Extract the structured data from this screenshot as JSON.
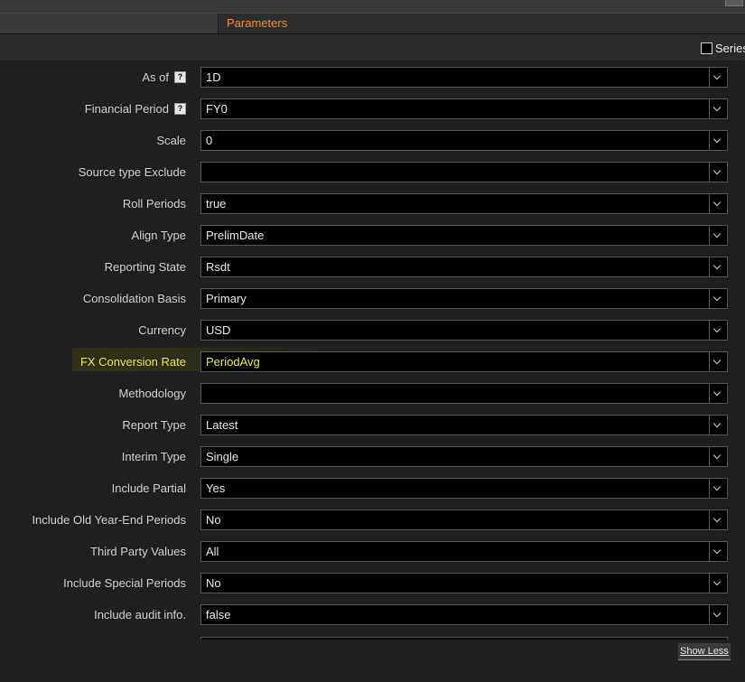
{
  "tabs": {
    "active_label": "Parameters"
  },
  "series": {
    "label": "Series",
    "checked": false
  },
  "fields": [
    {
      "label": "As of",
      "value": "1D",
      "help": "?"
    },
    {
      "label": "Financial Period",
      "value": "FY0",
      "help": "?"
    },
    {
      "label": "Scale",
      "value": "0"
    },
    {
      "label": "Source type Exclude",
      "value": ""
    },
    {
      "label": "Roll Periods",
      "value": "true"
    },
    {
      "label": "Align Type",
      "value": "PrelimDate"
    },
    {
      "label": "Reporting State",
      "value": "Rsdt"
    },
    {
      "label": "Consolidation Basis",
      "value": "Primary"
    },
    {
      "label": "Currency",
      "value": "USD"
    },
    {
      "label": "FX Conversion Rate",
      "value": "PeriodAvg"
    },
    {
      "label": "Methodology",
      "value": ""
    },
    {
      "label": "Report Type",
      "value": "Latest"
    },
    {
      "label": "Interim Type",
      "value": "Single"
    },
    {
      "label": "Include Partial",
      "value": "Yes"
    },
    {
      "label": "Include Old Year-End Periods",
      "value": "No"
    },
    {
      "label": "Third Party Values",
      "value": "All"
    },
    {
      "label": "Include Special Periods",
      "value": "No"
    },
    {
      "label": "Include audit info.",
      "value": "false"
    }
  ],
  "highlight_color": "#e8e84a",
  "accent_color": "#f08a24",
  "footer": {
    "show_less_label": "Show Less"
  }
}
